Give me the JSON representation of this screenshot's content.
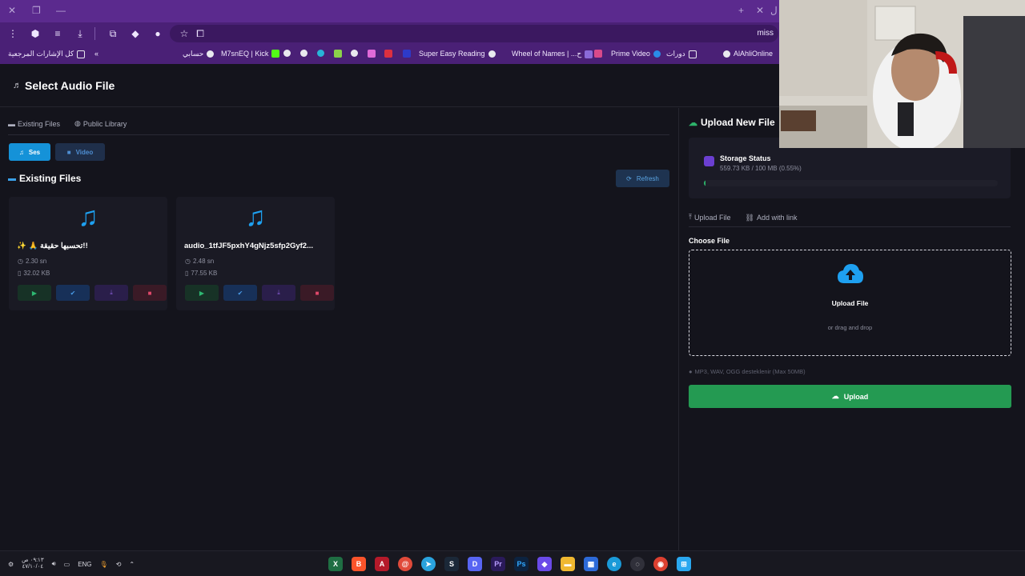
{
  "browser": {
    "url_partial": "miss",
    "tab_partial": "ل",
    "bookmarks": [
      {
        "label": "كل الإشارات المرجعية",
        "icon": "folder-icon"
      },
      {
        "label": "حسابي",
        "icon": "globe-icon"
      },
      {
        "label": "M7snEQ | Kick",
        "icon": "kick-icon"
      },
      {
        "label": "Super Easy Reading",
        "icon": "globe-icon"
      },
      {
        "label": "Wheel of Names | ...ح",
        "icon": "globe-icon"
      },
      {
        "label": "Prime Video",
        "icon": "prime-icon"
      },
      {
        "label": "دورات",
        "icon": "folder-icon"
      },
      {
        "label": "AlAhliOnline",
        "icon": "globe-icon"
      }
    ]
  },
  "app": {
    "title": "Select Audio File",
    "left": {
      "tabs": [
        {
          "label": "Existing Files",
          "icon": "folder-icon"
        },
        {
          "label": "Public Library",
          "icon": "globe-icon"
        }
      ],
      "type_buttons": [
        {
          "label": "Ses",
          "icon": "music-icon",
          "active": true
        },
        {
          "label": "Video",
          "icon": "video-icon",
          "active": false
        }
      ],
      "section_title": "Existing Files",
      "refresh_label": "Refresh",
      "files": [
        {
          "name": "✨ 🙏 تحسبها حقيقة!!",
          "duration": "2.30 sn",
          "size": "32.02 KB"
        },
        {
          "name": "audio_1tfJF5pxhY4gNjz5sfp2Gyf2...",
          "duration": "2.48 sn",
          "size": "77.55 KB"
        }
      ]
    },
    "right": {
      "title": "Upload New File",
      "storage_title": "Storage Status",
      "storage_value": "559.73 KB / 100 MB (0.55%)",
      "storage_fraction": 0.0055,
      "tabs": [
        {
          "label": "Upload File",
          "active": true
        },
        {
          "label": "Add with link",
          "active": false
        }
      ],
      "choose_label": "Choose File",
      "dropzone_main": "Upload File",
      "dropzone_sub": "or drag and drop",
      "hint": "MP3, WAV, OGG desteklenir (Max 50MB)",
      "upload_button": "Upload"
    }
  },
  "taskbar": {
    "time": "٠٩:١٣ ص",
    "date": "٤٧/١٠/٠٤",
    "language": "ENG"
  },
  "colors": {
    "accent_blue": "#1592d8",
    "upload_green": "#249a52",
    "browser_purple": "#4a2076"
  }
}
